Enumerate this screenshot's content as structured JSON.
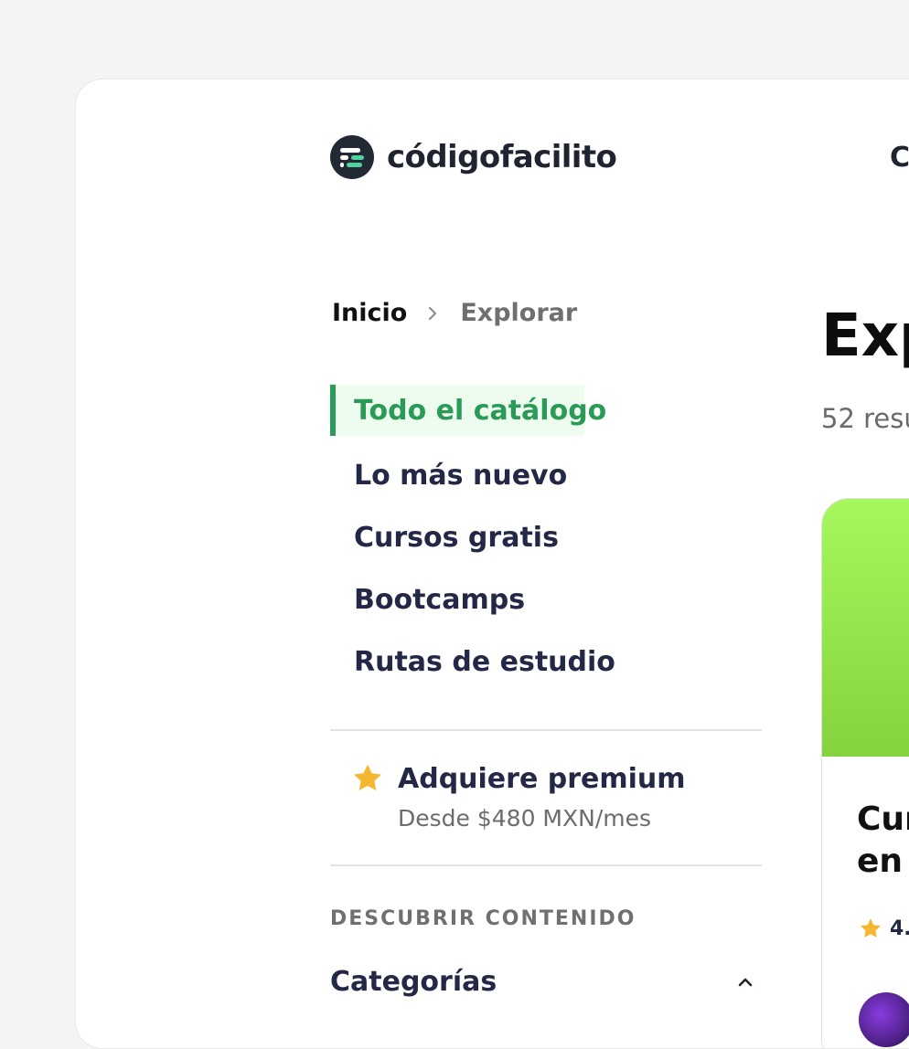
{
  "brand": {
    "name": "códigofacilito"
  },
  "top_nav": {
    "partial_label": "C"
  },
  "breadcrumb": {
    "home": "Inicio",
    "current": "Explorar"
  },
  "sidebar": {
    "active_item": "Todo el catálogo",
    "items": [
      "Lo más nuevo",
      "Cursos gratis",
      "Bootcamps",
      "Rutas de estudio"
    ]
  },
  "premium": {
    "title": "Adquiere premium",
    "price": "Desde $480 MXN/mes"
  },
  "discover": {
    "section_label": "DESCUBRIR CONTENIDO",
    "categories_label": "Categorías"
  },
  "main": {
    "title_partial": "Exp",
    "results_partial": "52 resu",
    "card": {
      "title_partial": "Cur\nen s",
      "rating_partial": "4."
    }
  },
  "colors": {
    "accent_green": "#2a9a57",
    "active_bg": "#eefbef",
    "nav_text": "#232846",
    "star": "#f5b731",
    "thumb_green": "#a7f75e",
    "logo_bg": "#232934"
  },
  "icons": [
    "logo-icon",
    "chevron-right-icon",
    "star-icon",
    "chevron-up-icon",
    "rating-star-icon"
  ]
}
